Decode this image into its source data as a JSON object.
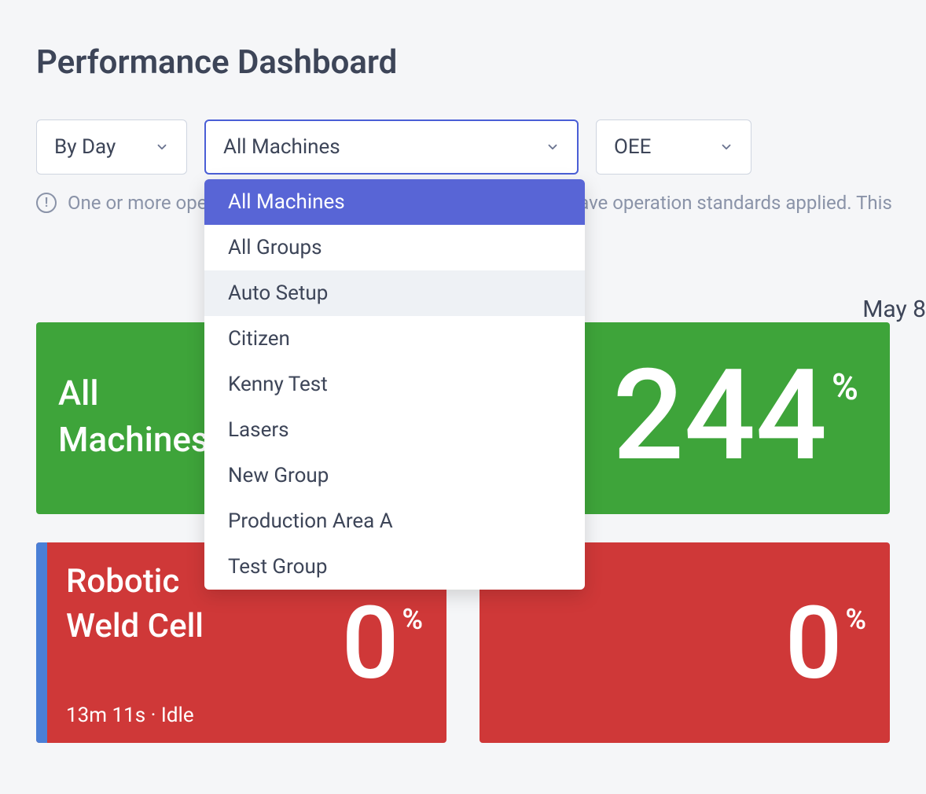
{
  "page": {
    "title": "Performance Dashboard"
  },
  "filters": {
    "by_day": {
      "label": "By Day"
    },
    "machines": {
      "label": "All Machines",
      "options": [
        "All Machines",
        "All Groups",
        "Auto Setup",
        "Citizen",
        "Kenny Test",
        "Lasers",
        "New Group",
        "Production Area A",
        "Test Group"
      ]
    },
    "metric": {
      "label": "OEE"
    }
  },
  "warning": {
    "text": "One or more operations completed in this timeframe do not have operation standards applied. This"
  },
  "date": "May 8",
  "cards": {
    "all_machines": {
      "title": "All Machines",
      "value": "244",
      "unit": "%"
    },
    "robotic_weld": {
      "title": "Robotic Weld Cell",
      "status": "13m 11s · Idle",
      "value": "0",
      "unit": "%"
    },
    "second_red": {
      "value": "0",
      "unit": "%"
    }
  }
}
